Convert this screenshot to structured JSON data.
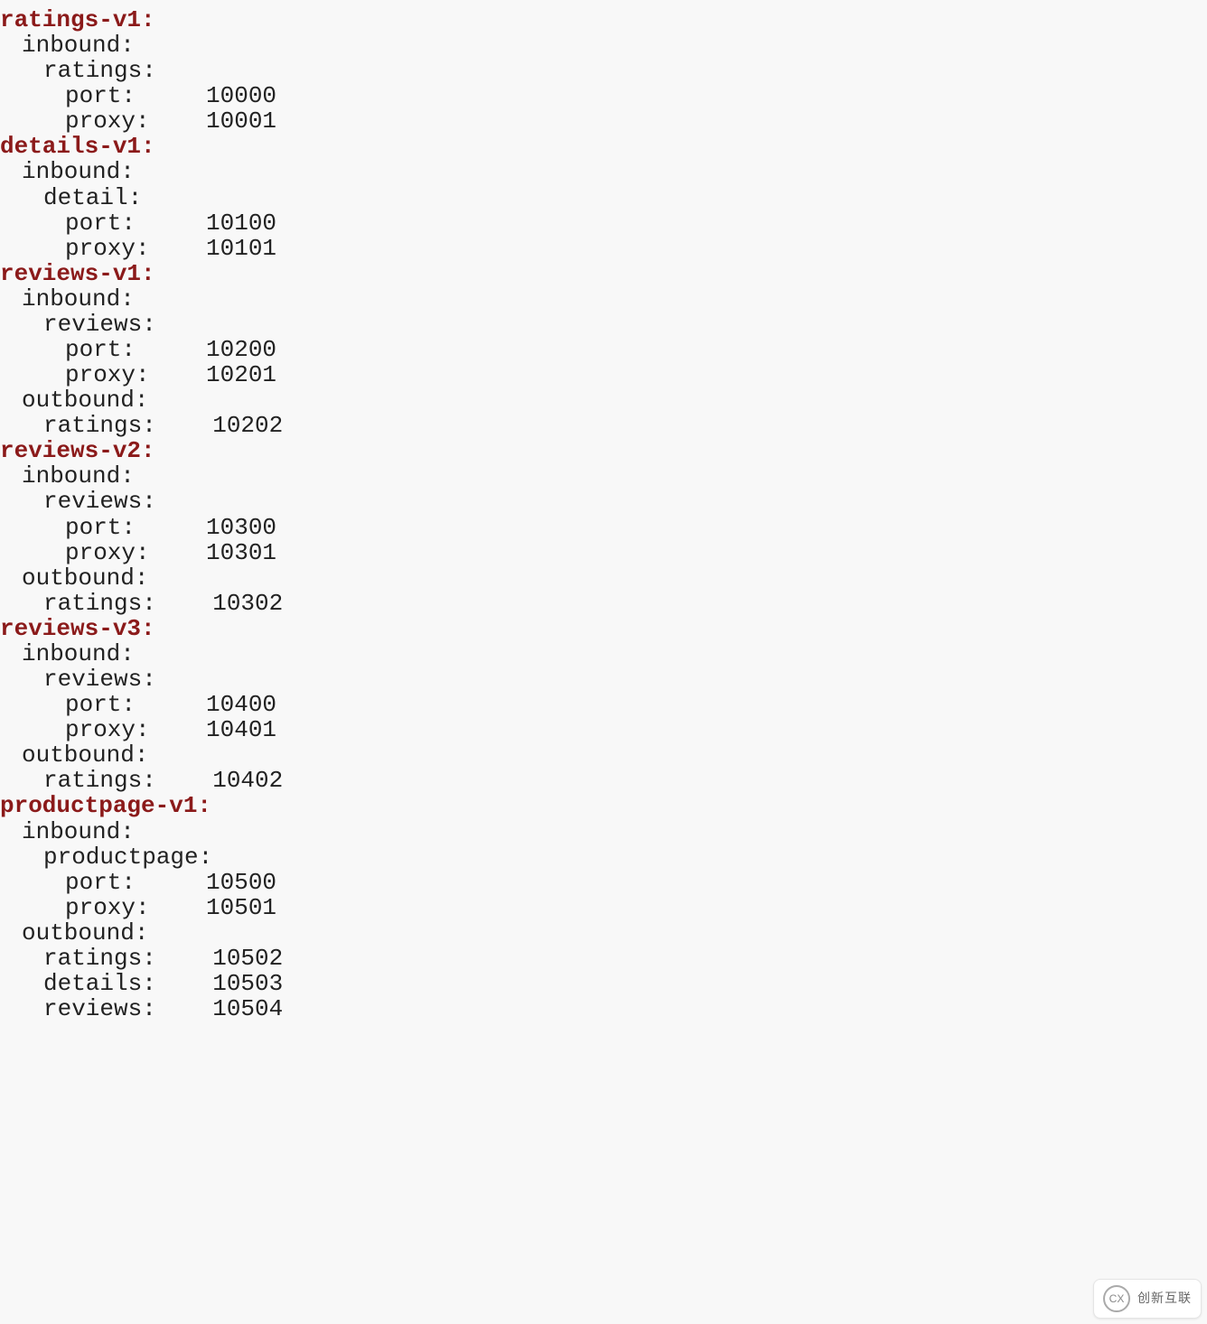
{
  "sections": [
    {
      "root": "ratings-v1:",
      "lines": [
        {
          "indent": 1,
          "key": "inbound:",
          "val": ""
        },
        {
          "indent": 2,
          "key": "ratings:",
          "val": ""
        },
        {
          "indent": 3,
          "key": "port:",
          "val": "10000"
        },
        {
          "indent": 3,
          "key": "proxy:",
          "val": "10001"
        }
      ]
    },
    {
      "root": "details-v1:",
      "lines": [
        {
          "indent": 1,
          "key": "inbound:",
          "val": ""
        },
        {
          "indent": 2,
          "key": "detail:",
          "val": ""
        },
        {
          "indent": 3,
          "key": "port:",
          "val": "10100"
        },
        {
          "indent": 3,
          "key": "proxy:",
          "val": "10101"
        }
      ]
    },
    {
      "root": "reviews-v1:",
      "lines": [
        {
          "indent": 1,
          "key": "inbound:",
          "val": ""
        },
        {
          "indent": 2,
          "key": "reviews:",
          "val": ""
        },
        {
          "indent": 3,
          "key": "port:",
          "val": "10200"
        },
        {
          "indent": 3,
          "key": "proxy:",
          "val": "10201"
        },
        {
          "indent": 1,
          "key": "outbound:",
          "val": ""
        },
        {
          "indent": 2,
          "key": "ratings:",
          "val": "10202"
        }
      ]
    },
    {
      "root": "reviews-v2:",
      "lines": [
        {
          "indent": 1,
          "key": "inbound:",
          "val": ""
        },
        {
          "indent": 2,
          "key": "reviews:",
          "val": ""
        },
        {
          "indent": 3,
          "key": "port:",
          "val": "10300"
        },
        {
          "indent": 3,
          "key": "proxy:",
          "val": "10301"
        },
        {
          "indent": 1,
          "key": "outbound:",
          "val": ""
        },
        {
          "indent": 2,
          "key": "ratings:",
          "val": "10302"
        }
      ]
    },
    {
      "root": "reviews-v3:",
      "lines": [
        {
          "indent": 1,
          "key": "inbound:",
          "val": ""
        },
        {
          "indent": 2,
          "key": "reviews:",
          "val": ""
        },
        {
          "indent": 3,
          "key": "port:",
          "val": "10400"
        },
        {
          "indent": 3,
          "key": "proxy:",
          "val": "10401"
        },
        {
          "indent": 1,
          "key": "outbound:",
          "val": ""
        },
        {
          "indent": 2,
          "key": "ratings:",
          "val": "10402"
        }
      ]
    },
    {
      "root": "productpage-v1:",
      "lines": [
        {
          "indent": 1,
          "key": "inbound:",
          "val": ""
        },
        {
          "indent": 2,
          "key": "productpage:",
          "val": ""
        },
        {
          "indent": 3,
          "key": "port:",
          "val": "10500"
        },
        {
          "indent": 3,
          "key": "proxy:",
          "val": "10501"
        },
        {
          "indent": 1,
          "key": "outbound:",
          "val": ""
        },
        {
          "indent": 2,
          "key": "ratings:",
          "val": "10502"
        },
        {
          "indent": 2,
          "key": "details:",
          "val": "10503"
        },
        {
          "indent": 2,
          "key": "reviews:",
          "val": "10504"
        }
      ]
    }
  ],
  "watermark": {
    "logo": "CX",
    "text": "创新互联"
  }
}
